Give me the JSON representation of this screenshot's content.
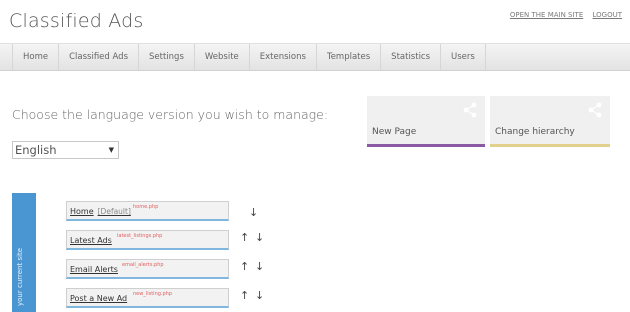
{
  "header": {
    "title": "Classified Ads",
    "links": [
      "OPEN THE MAIN SITE",
      "LOGOUT"
    ]
  },
  "nav": {
    "items": [
      "Home",
      "Classified Ads",
      "Settings",
      "Website",
      "Extensions",
      "Templates",
      "Statistics",
      "Users"
    ]
  },
  "main": {
    "choose_label": "Choose the language version you wish to manage:",
    "language_value": "English"
  },
  "tiles": {
    "new_page": "New Page",
    "change_hierarchy": "Change hierarchy",
    "icon": "share-icon"
  },
  "site_tree": {
    "bar_label": "your current site",
    "rows": [
      {
        "name": "Home",
        "default": "[Default]",
        "file": "home.php",
        "up": false,
        "down": true
      },
      {
        "name": "Latest Ads",
        "default": "",
        "file": "latest_listings.php",
        "up": true,
        "down": true
      },
      {
        "name": "Email Alerts",
        "default": "",
        "file": "email_alerts.php",
        "up": true,
        "down": true
      },
      {
        "name": "Post a New Ad",
        "default": "",
        "file": "new_listing.php",
        "up": true,
        "down": true
      }
    ]
  },
  "colors": {
    "accent_blue": "#4a96d2",
    "tile_purple": "#8a5aa3",
    "tile_yellow": "#e2cf8c"
  }
}
